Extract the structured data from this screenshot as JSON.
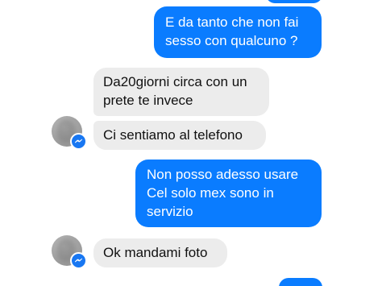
{
  "conversation": {
    "messages": [
      {
        "from": "me",
        "lines": [
          "E da tanto che non fai",
          "sesso con qualcuno ?"
        ]
      },
      {
        "from": "contact",
        "lines": [
          "Da20giorni circa con un",
          "prete te invece"
        ]
      },
      {
        "from": "contact",
        "lines": [
          "Ci sentiamo al telefono"
        ]
      },
      {
        "from": "me",
        "lines": [
          "Non posso adesso usare",
          "Cel solo mex sono in",
          "servizio"
        ]
      },
      {
        "from": "contact",
        "lines": [
          "Ok mandami foto"
        ]
      }
    ]
  },
  "icons": {
    "avatar": "contact-avatar",
    "badge": "messenger-icon"
  },
  "colors": {
    "sent_bubble": "#0a7cff",
    "received_bubble": "#ececec",
    "badge": "#1877f2"
  }
}
